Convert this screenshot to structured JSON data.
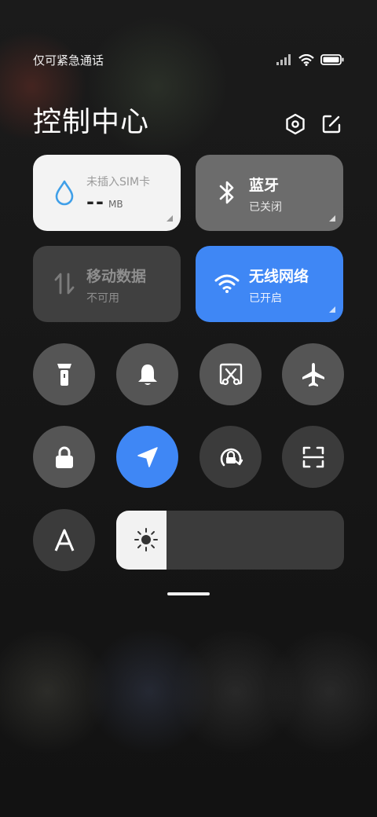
{
  "status_bar": {
    "carrier_text": "仅可紧急通话",
    "icons": [
      "signal-icon",
      "wifi-icon",
      "battery-icon"
    ]
  },
  "header": {
    "title": "控制中心",
    "settings_icon": "hexagon-settings-icon",
    "edit_icon": "edit-icon"
  },
  "tiles": {
    "data_usage": {
      "label": "未插入SIM卡",
      "value": "--",
      "unit": "MB",
      "icon": "water-drop-icon"
    },
    "bluetooth": {
      "title": "蓝牙",
      "status": "已关闭",
      "icon": "bluetooth-icon"
    },
    "mobile_data": {
      "title": "移动数据",
      "status": "不可用",
      "icon": "data-arrows-icon"
    },
    "wifi": {
      "title": "无线网络",
      "status": "已开启",
      "icon": "wifi-icon"
    }
  },
  "toggles": [
    {
      "name": "flashlight",
      "icon": "flashlight-icon",
      "active": false
    },
    {
      "name": "mute",
      "icon": "bell-icon",
      "active": false
    },
    {
      "name": "screenshot",
      "icon": "scissors-icon",
      "active": false
    },
    {
      "name": "airplane",
      "icon": "airplane-icon",
      "active": false
    },
    {
      "name": "lock",
      "icon": "lock-icon",
      "active": false
    },
    {
      "name": "location",
      "icon": "location-arrow-icon",
      "active": true
    },
    {
      "name": "rotation-lock",
      "icon": "rotation-lock-icon",
      "active": false
    },
    {
      "name": "scanner",
      "icon": "scan-icon",
      "active": false
    }
  ],
  "bottom": {
    "reading_mode_icon": "font-a-icon",
    "brightness_icon": "sun-icon",
    "brightness_level": 0.22
  },
  "colors": {
    "accent": "#3f87f5",
    "tile_light": "#f3f3f3",
    "tile_gray": "#6c6c6c",
    "tile_dim": "#404040",
    "round_gray": "#555555"
  }
}
